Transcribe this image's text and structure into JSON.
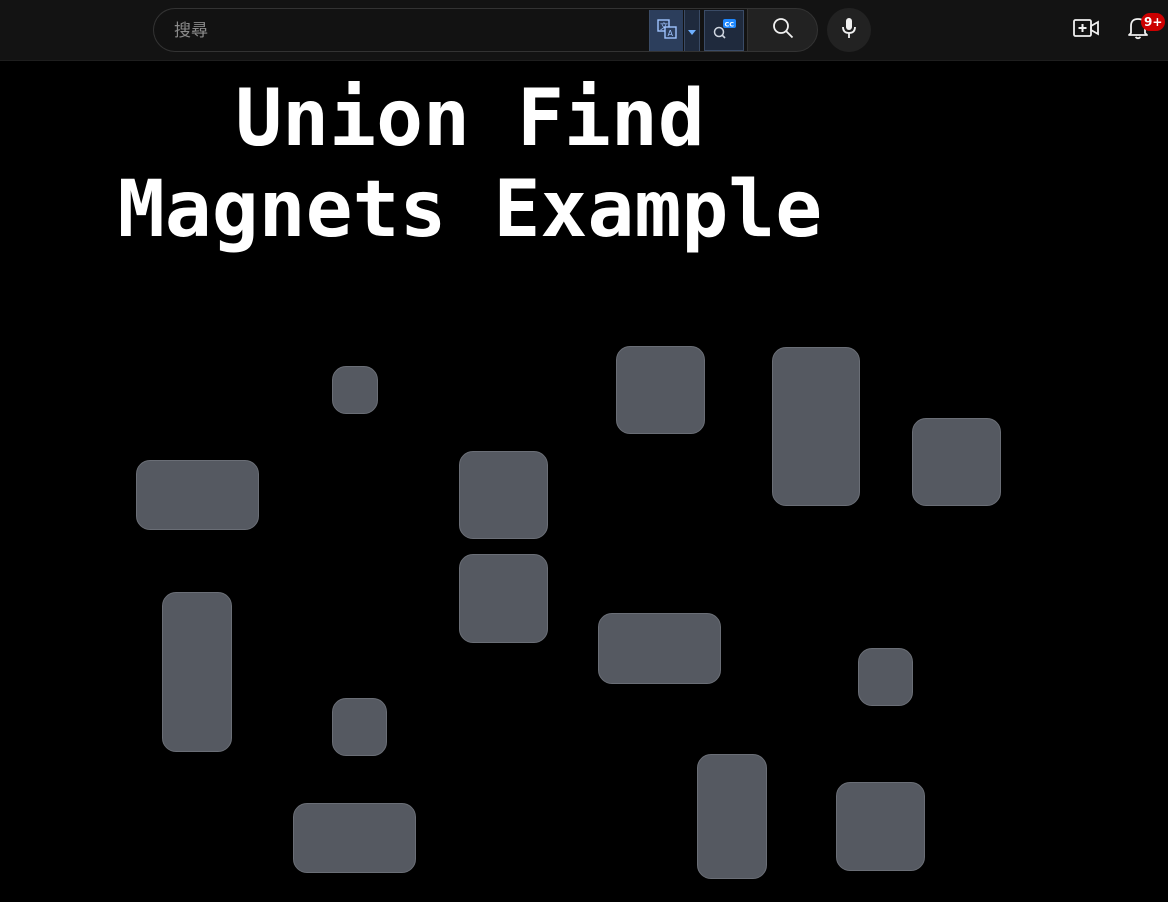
{
  "header": {
    "search": {
      "placeholder": "搜尋",
      "value": ""
    },
    "notifications": {
      "badge": "9+"
    },
    "icons": [
      "translate-icon",
      "dropdown-caret-icon",
      "caption-search-icon",
      "search-icon",
      "microphone-icon",
      "create-video-icon",
      "bell-icon"
    ]
  },
  "video": {
    "title_line1": "Union Find",
    "title_line2": "Magnets Example",
    "block_color": "#555961"
  }
}
